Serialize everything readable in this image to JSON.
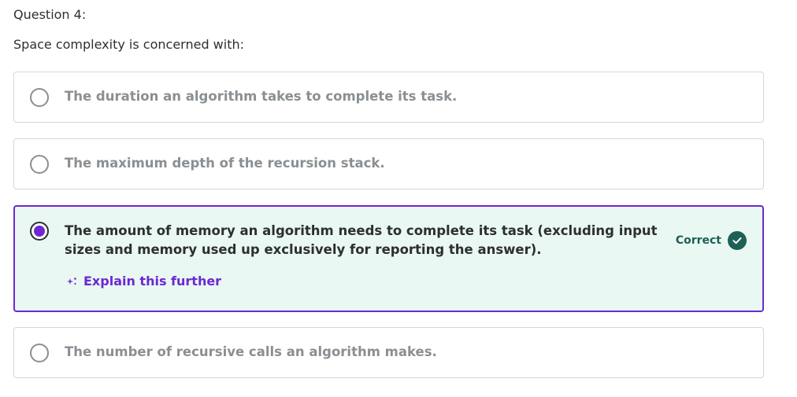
{
  "question": {
    "label": "Question 4:",
    "prompt": "Space complexity is concerned with:"
  },
  "options": [
    {
      "text": "The duration an algorithm takes to complete its task.",
      "selected": false
    },
    {
      "text": "The maximum depth of the recursion stack.",
      "selected": false
    },
    {
      "text": "The amount of memory an algorithm needs to complete its task (excluding input sizes and memory used up exclusively for reporting the answer).",
      "selected": true,
      "status_label": "Correct",
      "explain_label": "Explain this further"
    },
    {
      "text": "The number of recursive calls an algorithm makes.",
      "selected": false
    }
  ],
  "colors": {
    "accent": "#6d28d2",
    "correct": "#1e6055",
    "selected_bg": "#e9f8f3",
    "muted_text": "#8a8f93",
    "border": "#d1d7dc"
  },
  "icons": {
    "explain": "sparkle-icon",
    "status": "check-circle-icon",
    "unselected": "radio-empty-icon",
    "selected": "radio-filled-icon"
  }
}
